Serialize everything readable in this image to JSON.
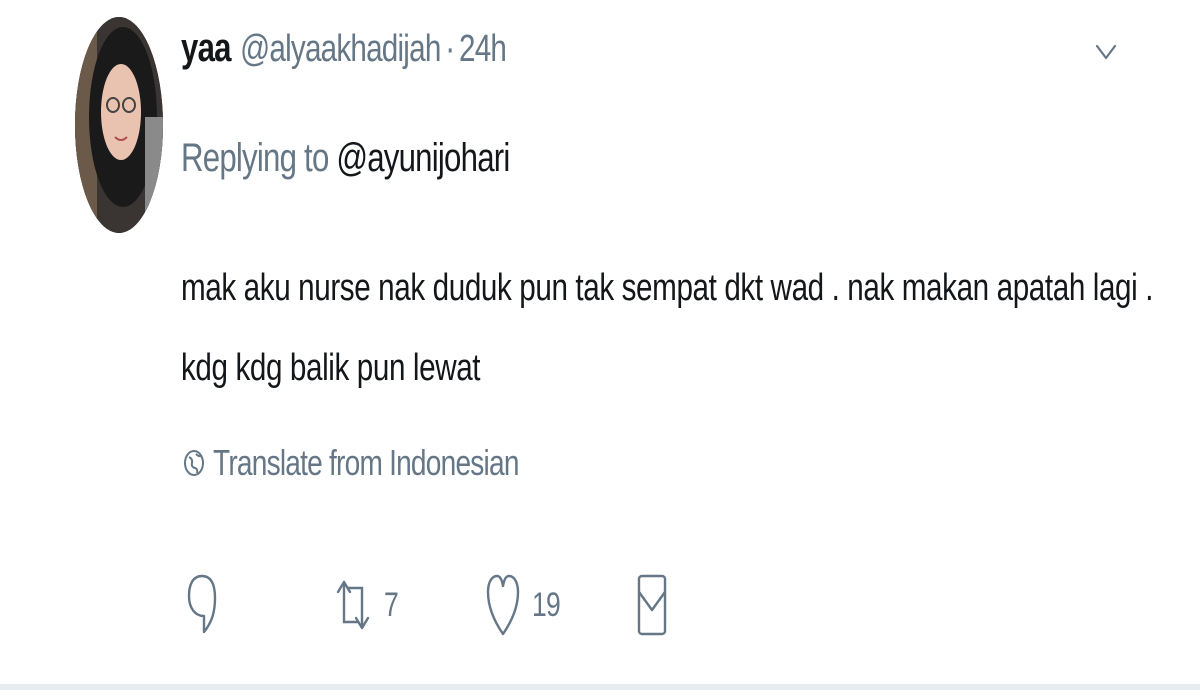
{
  "tweet": {
    "display_name": "yaa",
    "handle": "@alyaakhadijah",
    "separator": "·",
    "time": "24h",
    "reply_prefix": "Replying to",
    "reply_target": "@ayunijohari",
    "text_lines": [
      "mak aku nurse nak duduk pun tak sempat dkt wad . nak makan apatah lagi .",
      "kdg kdg balik pun lewat"
    ],
    "translate_label": "Translate from Indonesian"
  },
  "actions": {
    "reply_icon": "reply-icon",
    "retweet_icon": "retweet-icon",
    "retweet_count": "7",
    "like_icon": "heart-icon",
    "like_count": "19",
    "dm_icon": "message-icon"
  },
  "colors": {
    "secondary_text": "#657786",
    "primary_text": "#14171a",
    "divider": "#e6ecf0"
  }
}
